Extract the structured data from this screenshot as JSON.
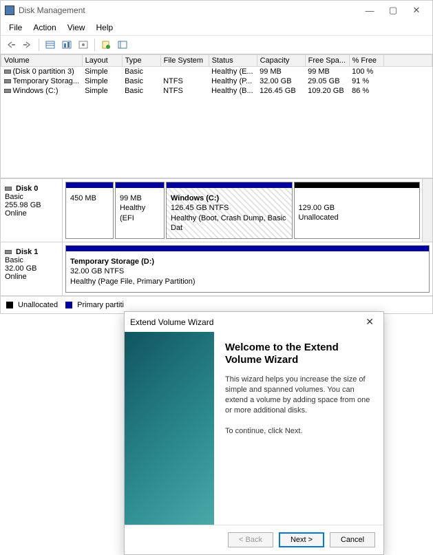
{
  "window": {
    "title": "Disk Management",
    "menu": [
      "File",
      "Action",
      "View",
      "Help"
    ]
  },
  "table": {
    "headers": [
      "Volume",
      "Layout",
      "Type",
      "File System",
      "Status",
      "Capacity",
      "Free Spa...",
      "% Free"
    ],
    "rows": [
      {
        "volume": "(Disk 0 partition 3)",
        "layout": "Simple",
        "type": "Basic",
        "fs": "",
        "status": "Healthy (E...",
        "capacity": "99 MB",
        "free": "99 MB",
        "pct": "100 %"
      },
      {
        "volume": "Temporary Storag...",
        "layout": "Simple",
        "type": "Basic",
        "fs": "NTFS",
        "status": "Healthy (P...",
        "capacity": "32.00 GB",
        "free": "29.05 GB",
        "pct": "91 %"
      },
      {
        "volume": "Windows (C:)",
        "layout": "Simple",
        "type": "Basic",
        "fs": "NTFS",
        "status": "Healthy (B...",
        "capacity": "126.45 GB",
        "free": "109.20 GB",
        "pct": "86 %"
      }
    ]
  },
  "disks": {
    "d0": {
      "name": "Disk 0",
      "kind": "Basic",
      "size": "255.98 GB",
      "state": "Online",
      "segs": [
        {
          "title": "",
          "l1": "450 MB",
          "l2": ""
        },
        {
          "title": "",
          "l1": "99 MB",
          "l2": "Healthy (EFI"
        },
        {
          "title": "Windows  (C:)",
          "l1": "126.45 GB NTFS",
          "l2": "Healthy (Boot, Crash Dump, Basic Dat"
        },
        {
          "title": "",
          "l1": "129.00 GB",
          "l2": "Unallocated"
        }
      ]
    },
    "d1": {
      "name": "Disk 1",
      "kind": "Basic",
      "size": "32.00 GB",
      "state": "Online",
      "seg": {
        "title": "Temporary Storage  (D:)",
        "l1": "32.00 GB NTFS",
        "l2": "Healthy (Page File, Primary Partition)"
      }
    }
  },
  "legend": {
    "unalloc": "Unallocated",
    "primary": "Primary partiti"
  },
  "wizard": {
    "title": "Extend Volume Wizard",
    "heading": "Welcome to the Extend Volume Wizard",
    "p1": "This wizard helps you increase the size of simple and spanned volumes. You can extend a volume  by adding space from one or more additional disks.",
    "p2": "To continue, click Next.",
    "back": "< Back",
    "next": "Next >",
    "cancel": "Cancel"
  }
}
